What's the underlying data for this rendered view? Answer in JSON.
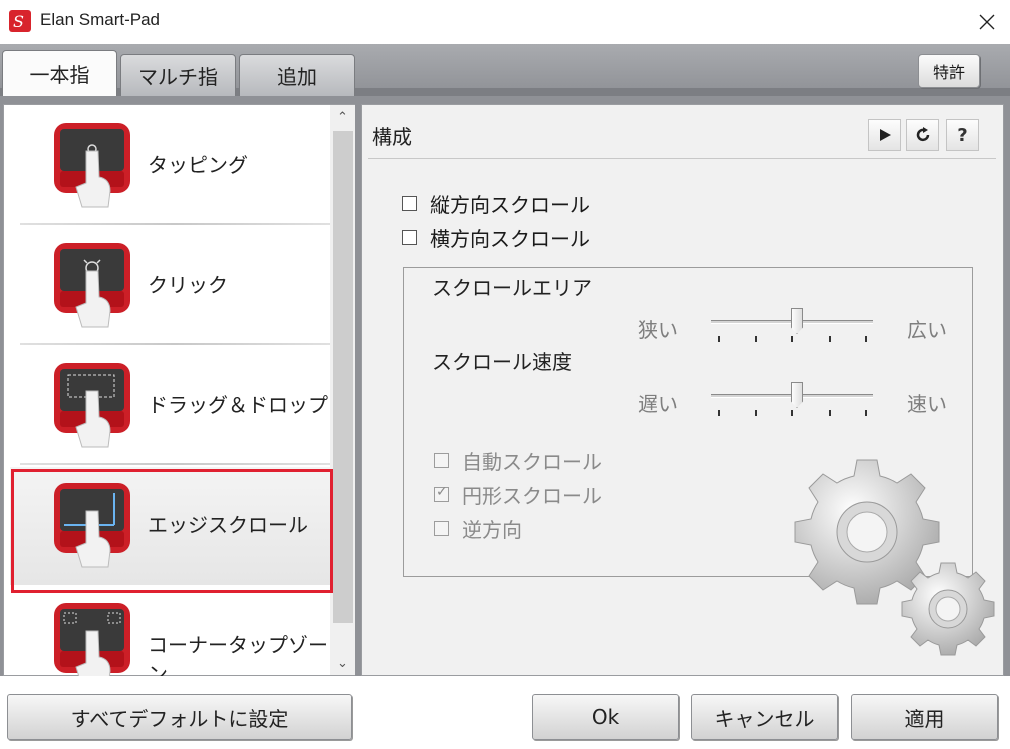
{
  "window": {
    "title": "Elan Smart-Pad",
    "app_icon": "elan-logo-icon",
    "close_icon": "close-icon"
  },
  "tabs": [
    {
      "label": "一本指",
      "active": true
    },
    {
      "label": "マルチ指",
      "active": false
    },
    {
      "label": "追加",
      "active": false
    }
  ],
  "patent_button": "特許",
  "list_items": [
    {
      "label": "タッピング",
      "icon": "tap-gesture-icon"
    },
    {
      "label": "クリック",
      "icon": "click-gesture-icon"
    },
    {
      "label": "ドラッグ＆ドロップ",
      "icon": "drag-drop-gesture-icon"
    },
    {
      "label": "エッジスクロール",
      "icon": "edge-scroll-gesture-icon",
      "selected": true
    },
    {
      "label": "コーナータップゾーン",
      "icon": "corner-tap-gesture-icon"
    }
  ],
  "config": {
    "title": "構成",
    "toolbar": {
      "play_icon": "play-icon",
      "reset_icon": "refresh-icon",
      "help_label": "?"
    },
    "vertical_scroll": {
      "label": "縦方向スクロール",
      "checked": false
    },
    "horizontal_scroll": {
      "label": "横方向スクロール",
      "checked": false
    },
    "scroll_area": {
      "label": "スクロールエリア",
      "min_label": "狭い",
      "max_label": "広い",
      "value": 0.5
    },
    "scroll_speed": {
      "label": "スクロール速度",
      "min_label": "遅い",
      "max_label": "速い",
      "value": 0.5
    },
    "auto_scroll": {
      "label": "自動スクロール",
      "checked": false,
      "enabled": false
    },
    "circular_scroll": {
      "label": "円形スクロール",
      "checked": true,
      "enabled": false
    },
    "reverse": {
      "label": "逆方向",
      "checked": false,
      "enabled": false
    }
  },
  "buttons": {
    "default": "すべてデフォルトに設定",
    "ok": "Ok",
    "cancel": "キャンセル",
    "apply": "適用"
  },
  "colors": {
    "accent_red": "#d8242c",
    "selection_border": "#e02030"
  }
}
